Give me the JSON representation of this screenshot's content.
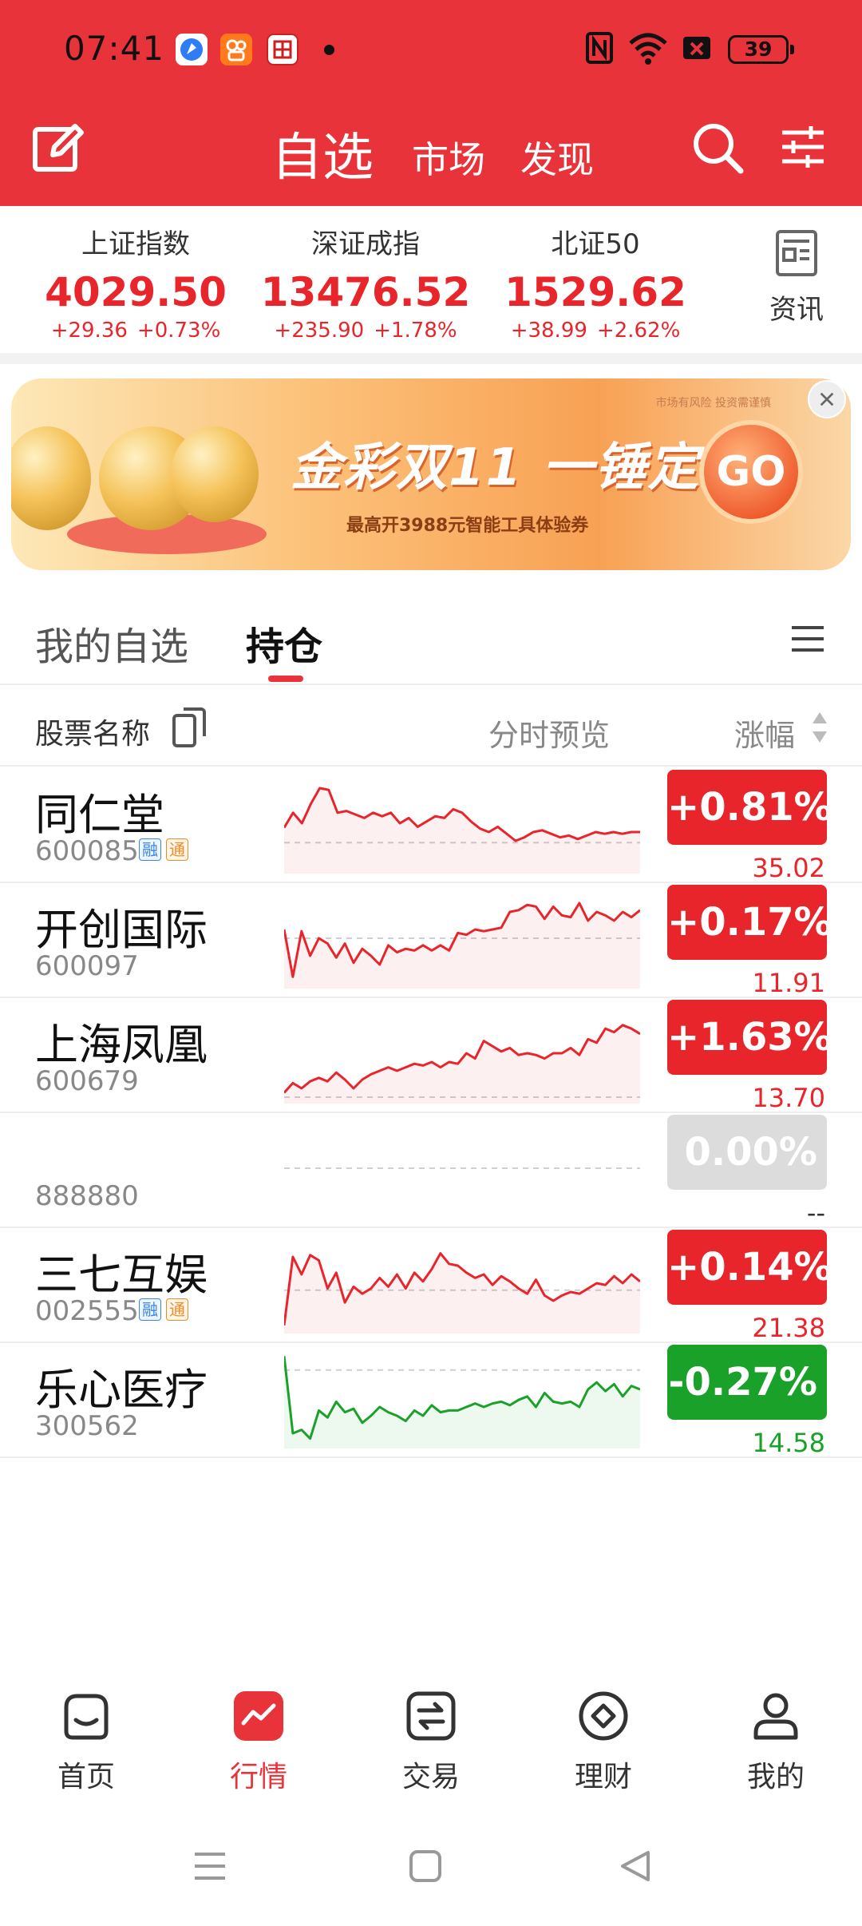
{
  "status_bar": {
    "time": "07:41",
    "battery": "39",
    "icons": [
      "browser-app-icon",
      "kuaishou-app-icon",
      "news-app-icon",
      "nfc-icon",
      "wifi-icon",
      "sim-off-icon",
      "battery-icon"
    ]
  },
  "header": {
    "tabs": [
      {
        "label": "自选",
        "active": true
      },
      {
        "label": "市场",
        "active": false
      },
      {
        "label": "发现",
        "active": false
      }
    ],
    "icons": [
      "edit-icon",
      "search-icon",
      "filter-settings-icon"
    ]
  },
  "indices": [
    {
      "name": "上证指数",
      "value": "4029.50",
      "change": "+29.36",
      "percent": "+0.73%"
    },
    {
      "name": "深证成指",
      "value": "13476.52",
      "change": "+235.90",
      "percent": "+1.78%"
    },
    {
      "name": "北证50",
      "value": "1529.62",
      "change": "+38.99",
      "percent": "+2.62%"
    }
  ],
  "news": {
    "label": "资讯",
    "icon": "news-doc-icon"
  },
  "banner": {
    "risk_notice": "市场有风险 投资需谨慎",
    "title": "金彩双11 一锤定财",
    "subtitle": "最高开3988元智能工具体验券",
    "cta": "GO"
  },
  "list_tabs": [
    {
      "label": "我的自选",
      "active": false
    },
    {
      "label": "持仓",
      "active": true
    }
  ],
  "columns": {
    "name": "股票名称",
    "preview": "分时预览",
    "change": "涨幅"
  },
  "colors": {
    "brand_red": "#e8333a",
    "up_red": "#e8252b",
    "down_green": "#1aa12a",
    "flat_gray": "#dcdcdc"
  },
  "stocks": [
    {
      "name": "同仁堂",
      "code": "600085",
      "tags": [
        "融",
        "通"
      ],
      "change": "+0.81%",
      "price": "35.02",
      "trend": "up",
      "spark": [
        0.45,
        0.62,
        0.5,
        0.72,
        0.9,
        0.88,
        0.62,
        0.64,
        0.6,
        0.56,
        0.62,
        0.58,
        0.62,
        0.5,
        0.56,
        0.46,
        0.52,
        0.58,
        0.56,
        0.66,
        0.62,
        0.52,
        0.44,
        0.4,
        0.46,
        0.38,
        0.3,
        0.34,
        0.4,
        0.42,
        0.38,
        0.34,
        0.36,
        0.32,
        0.36,
        0.4,
        0.38,
        0.4,
        0.38,
        0.4,
        0.4
      ],
      "base": 0.28
    },
    {
      "name": "开创国际",
      "code": "600097",
      "tags": [],
      "change": "+0.17%",
      "price": "11.91",
      "trend": "up",
      "spark": [
        0.6,
        0.06,
        0.58,
        0.3,
        0.5,
        0.44,
        0.28,
        0.44,
        0.22,
        0.38,
        0.3,
        0.2,
        0.42,
        0.34,
        0.38,
        0.36,
        0.42,
        0.36,
        0.42,
        0.36,
        0.56,
        0.54,
        0.6,
        0.58,
        0.6,
        0.62,
        0.8,
        0.82,
        0.88,
        0.86,
        0.72,
        0.86,
        0.76,
        0.74,
        0.9,
        0.7,
        0.8,
        0.76,
        0.7,
        0.8,
        0.74,
        0.82
      ],
      "base": 0.5
    },
    {
      "name": "上海凤凰",
      "code": "600679",
      "tags": [],
      "change": "+1.63%",
      "price": "13.70",
      "trend": "up",
      "spark": [
        0.05,
        0.16,
        0.1,
        0.18,
        0.22,
        0.18,
        0.28,
        0.2,
        0.1,
        0.2,
        0.26,
        0.3,
        0.34,
        0.3,
        0.34,
        0.38,
        0.36,
        0.4,
        0.34,
        0.4,
        0.38,
        0.5,
        0.44,
        0.64,
        0.58,
        0.52,
        0.56,
        0.48,
        0.5,
        0.48,
        0.44,
        0.5,
        0.5,
        0.56,
        0.48,
        0.66,
        0.62,
        0.78,
        0.74,
        0.82,
        0.78,
        0.72
      ],
      "base": 0.0
    },
    {
      "name": "",
      "code": "888880",
      "tags": [],
      "change": "0.00%",
      "price": "--",
      "trend": "flat",
      "spark": [],
      "base": 0.5
    },
    {
      "name": "三七互娱",
      "code": "002555",
      "tags": [
        "融",
        "通"
      ],
      "change": "+0.14%",
      "price": "21.38",
      "trend": "up",
      "spark": [
        0.02,
        0.8,
        0.6,
        0.82,
        0.76,
        0.44,
        0.62,
        0.28,
        0.46,
        0.38,
        0.44,
        0.56,
        0.46,
        0.6,
        0.44,
        0.62,
        0.52,
        0.66,
        0.84,
        0.72,
        0.7,
        0.62,
        0.56,
        0.6,
        0.48,
        0.58,
        0.52,
        0.44,
        0.38,
        0.54,
        0.36,
        0.3,
        0.36,
        0.4,
        0.38,
        0.44,
        0.5,
        0.48,
        0.58,
        0.5,
        0.6,
        0.52
      ],
      "base": 0.42
    },
    {
      "name": "乐心医疗",
      "code": "300562",
      "tags": [],
      "change": "-0.27%",
      "price": "14.58",
      "trend": "down",
      "spark": [
        0.98,
        0.1,
        0.14,
        0.04,
        0.36,
        0.28,
        0.46,
        0.34,
        0.38,
        0.22,
        0.3,
        0.4,
        0.34,
        0.3,
        0.24,
        0.36,
        0.3,
        0.42,
        0.34,
        0.36,
        0.36,
        0.4,
        0.44,
        0.4,
        0.44,
        0.46,
        0.42,
        0.48,
        0.52,
        0.4,
        0.56,
        0.46,
        0.44,
        0.46,
        0.4,
        0.6,
        0.68,
        0.58,
        0.66,
        0.52,
        0.64,
        0.6
      ],
      "base": 0.82
    }
  ],
  "bottom_nav": [
    {
      "label": "首页",
      "icon": "home-icon",
      "active": false
    },
    {
      "label": "行情",
      "icon": "market-chart-icon",
      "active": true
    },
    {
      "label": "交易",
      "icon": "trade-exchange-icon",
      "active": false
    },
    {
      "label": "理财",
      "icon": "wealth-diamond-icon",
      "active": false
    },
    {
      "label": "我的",
      "icon": "profile-icon",
      "active": false
    }
  ],
  "system_nav": [
    "menu-nav-icon",
    "home-square-icon",
    "back-triangle-icon"
  ]
}
